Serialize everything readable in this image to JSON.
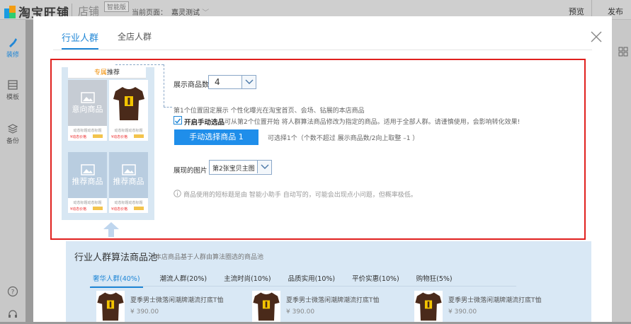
{
  "topbar": {
    "logo_text": "淘宝旺铺",
    "shop_text": "店铺",
    "edition": "智能版",
    "current_page_label": "当前页面：",
    "current_page_value": "嘉灵测试",
    "preview": "预览",
    "publish": "发布"
  },
  "sidebar": {
    "items": [
      {
        "label": "装修",
        "icon": "brush-icon",
        "active": true
      },
      {
        "label": "模板",
        "icon": "template-icon"
      },
      {
        "label": "备份",
        "icon": "layers-icon"
      }
    ]
  },
  "modal": {
    "tabs": [
      {
        "label": "行业人群",
        "active": true
      },
      {
        "label": "全店人群"
      }
    ],
    "preview": {
      "title_highlight": "专属",
      "title_rest": "推荐",
      "intent_label": "意向商品",
      "rec_label": "推荐商品",
      "item_title": "动态标题动态标题",
      "item_price": "¥动态价格"
    },
    "display_count_label": "展示商品数",
    "display_count_value": "4",
    "fixed_note": "第1个位置固定展示 个性化曝光在淘宝首页、会场、钻展的本店商品",
    "manual_check_label": "开启手动选品",
    "manual_check_desc": "可从第2个位置开始 将人群算法商品修改为指定的商品。适用于全部人群。请谨慎使用，会影响转化效果!",
    "manual_button": "手动选择商品 1",
    "manual_hint": "可选择1个（个数不超过 展示商品数/2向上取整  –1 ）",
    "image_label": "展现的图片",
    "image_value": "第2张宝贝主图",
    "info_text": "商品使用的短标题是由 智能小助手 自动写的，可能会出现点小问题，但概率极低。"
  },
  "pool": {
    "title": "行业人群算法商品池",
    "subtitle": "本店商品基于人群由算法圈选的商品池",
    "tabs": [
      {
        "label": "奢华人群(40%)",
        "active": true
      },
      {
        "label": "潮流人群(20%)"
      },
      {
        "label": "主流时尚(10%)"
      },
      {
        "label": "品质实用(10%)"
      },
      {
        "label": "平价实惠(10%)"
      },
      {
        "label": "购物狂(5%)"
      }
    ],
    "products": [
      {
        "name": "夏季男士微落闲潮牌潮流打底T恤",
        "price": "¥ 390.00"
      },
      {
        "name": "夏季男士微落闲潮牌潮流打底T恤",
        "price": "¥ 390.00"
      },
      {
        "name": "夏季男士微落闲潮牌潮流打底T恤",
        "price": "¥ 390.00"
      }
    ]
  },
  "colors": {
    "accent": "#1f86d6",
    "highlight_border": "#e0201e",
    "pool_bg": "#d9e8f5"
  }
}
